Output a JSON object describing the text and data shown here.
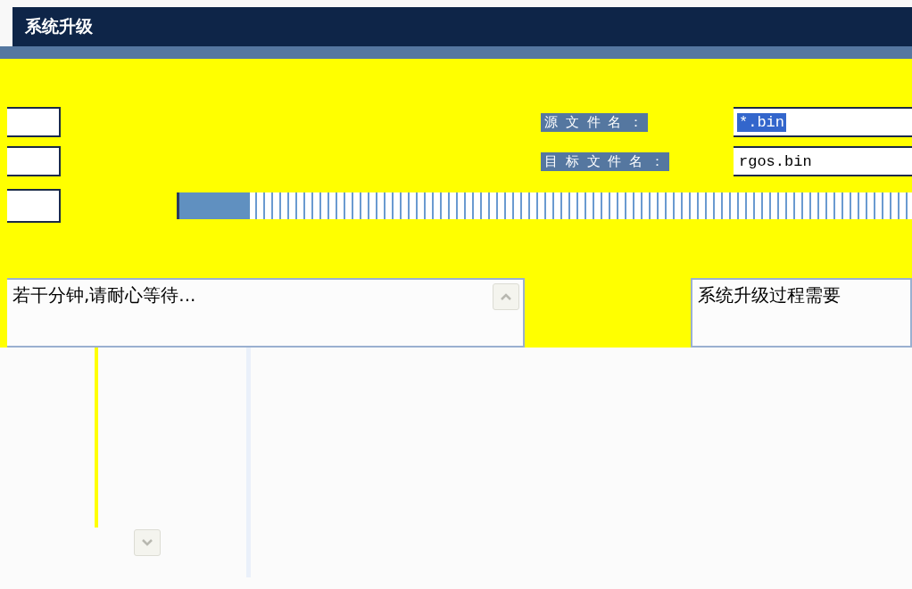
{
  "window": {
    "title": "系统升级"
  },
  "form": {
    "rows": [
      {
        "label": "源 文 件 名 ：",
        "value": "*.bin",
        "selected": true
      },
      {
        "label": "目 标 文 件 名 ：",
        "value": "rgos.bin",
        "selected": false
      }
    ]
  },
  "progress": {
    "level": 0.1
  },
  "messages": [
    {
      "text": "若干分钟,请耐心等待..."
    },
    {
      "text": "系统升级过程需要"
    }
  ]
}
